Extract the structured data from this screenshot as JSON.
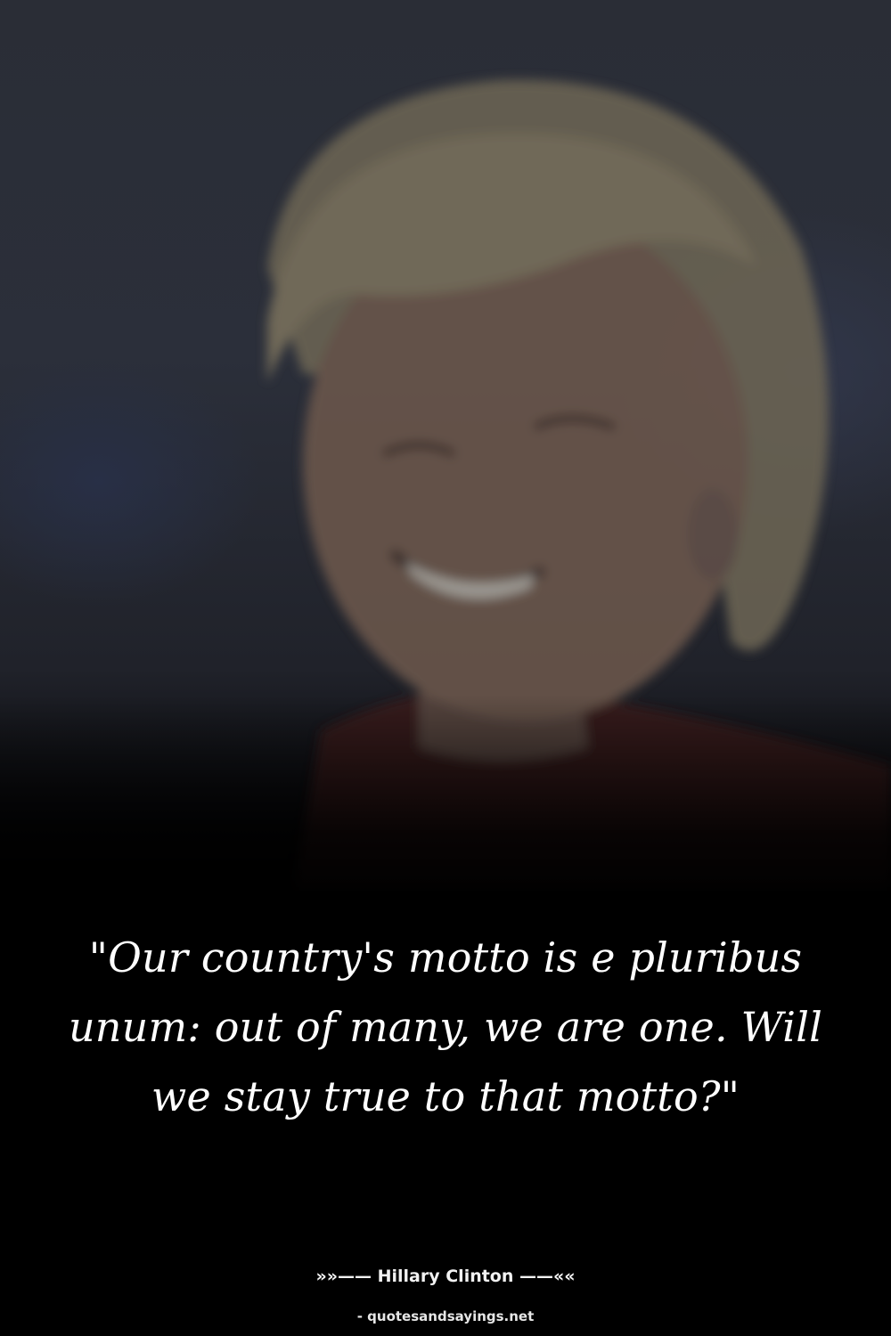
{
  "quote": {
    "text": "\"Our country's motto is e pluribus unum: out of many, we are one. Will we stay true to that motto?\""
  },
  "attribution": {
    "author_line": "»»—— Hillary Clinton ——««"
  },
  "watermark": {
    "text": "- quotesandsayings.net"
  },
  "photo": {
    "subject": "smiling woman with short blonde hair in red jacket, blurred background",
    "colors": {
      "background": "#000000",
      "text": "#ffffff"
    }
  }
}
